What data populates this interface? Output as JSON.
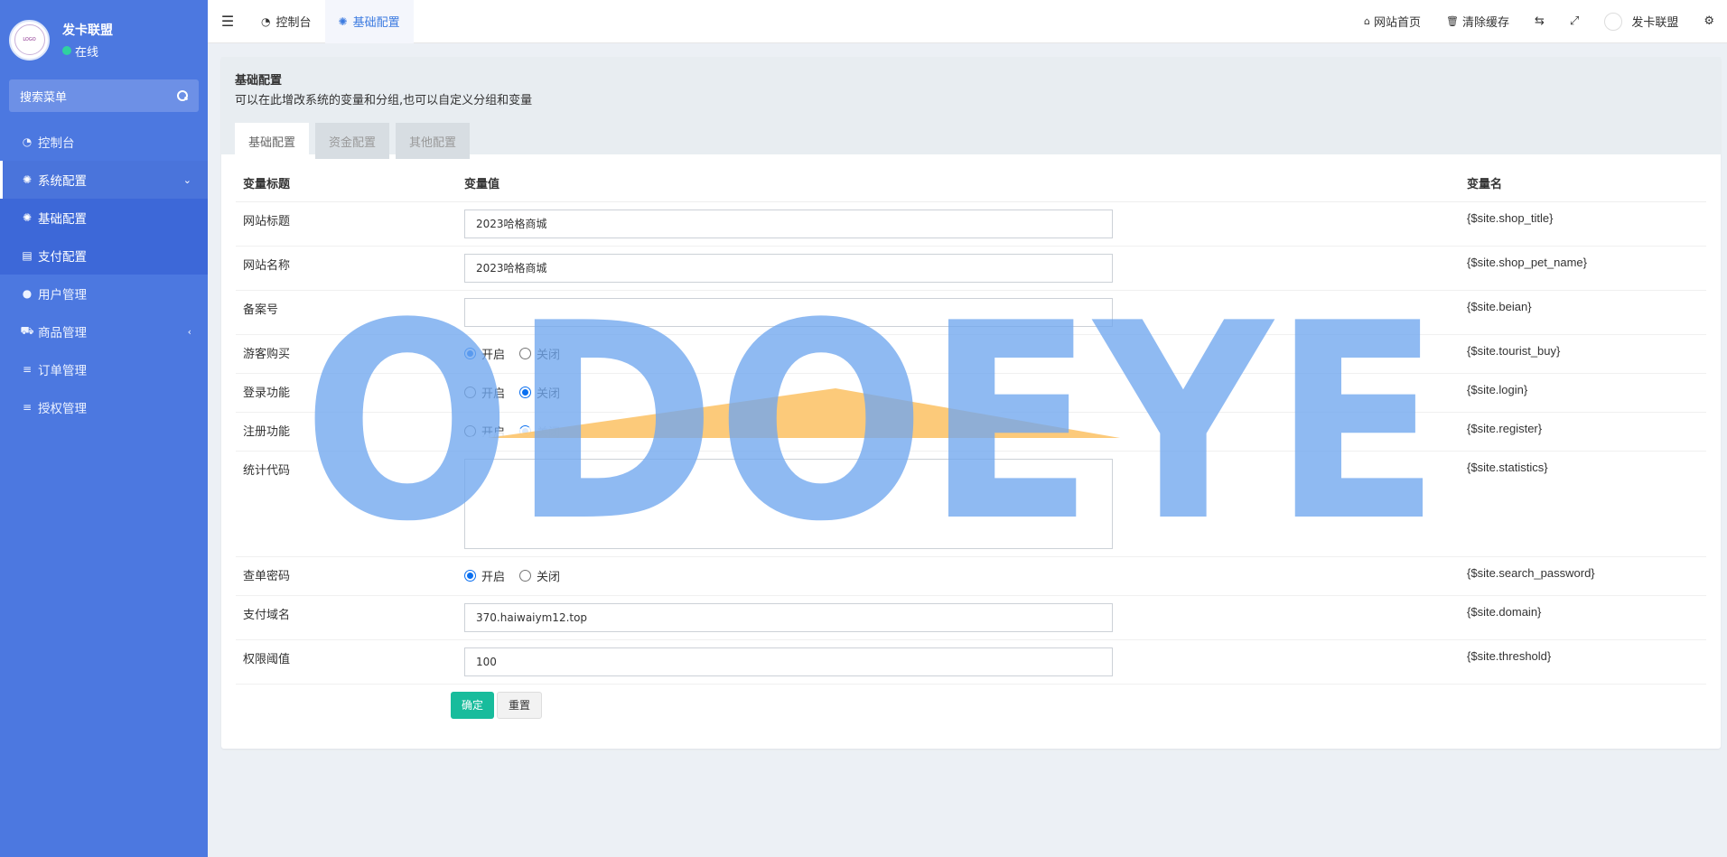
{
  "sidebar": {
    "user_name": "发卡联盟",
    "status": "在线",
    "search_placeholder": "搜索菜单",
    "items": [
      {
        "label": "控制台",
        "icon": "dashboard-icon"
      },
      {
        "label": "系统配置",
        "icon": "gear-icon"
      },
      {
        "label": "基础配置",
        "icon": "gear-icon"
      },
      {
        "label": "支付配置",
        "icon": "table-icon"
      },
      {
        "label": "用户管理",
        "icon": "user-icon"
      },
      {
        "label": "商品管理",
        "icon": "cart-icon"
      },
      {
        "label": "订单管理",
        "icon": "list-icon"
      },
      {
        "label": "授权管理",
        "icon": "list-icon"
      }
    ]
  },
  "topbar": {
    "tabs": [
      {
        "label": "控制台",
        "icon": "dashboard-icon"
      },
      {
        "label": "基础配置",
        "icon": "gear-icon"
      }
    ],
    "home": "网站首页",
    "clear_cache": "清除缓存",
    "user": "发卡联盟"
  },
  "panel": {
    "title": "基础配置",
    "desc": "可以在此增改系统的变量和分组,也可以自定义分组和变量",
    "tabs": [
      "基础配置",
      "资金配置",
      "其他配置"
    ]
  },
  "table": {
    "headers": [
      "变量标题",
      "变量值",
      "变量名"
    ],
    "rows": [
      {
        "label": "网站标题",
        "value": "2023哈格商城",
        "var": "{$site.shop_title}"
      },
      {
        "label": "网站名称",
        "value": "2023哈格商城",
        "var": "{$site.shop_pet_name}"
      },
      {
        "label": "备案号",
        "value": "",
        "var": "{$site.beian}"
      },
      {
        "label": "游客购买",
        "var": "{$site.tourist_buy}",
        "opt_on": "开启",
        "opt_off": "关闭",
        "selected": "开启"
      },
      {
        "label": "登录功能",
        "var": "{$site.login}",
        "opt_on": "开启",
        "opt_off": "关闭",
        "selected": "关闭"
      },
      {
        "label": "注册功能",
        "var": "{$site.register}",
        "opt_on": "开启",
        "opt_off": "关闭",
        "selected": "关闭"
      },
      {
        "label": "统计代码",
        "value": "",
        "var": "{$site.statistics}"
      },
      {
        "label": "查单密码",
        "var": "{$site.search_password}",
        "opt_on": "开启",
        "opt_off": "关闭",
        "selected": "开启"
      },
      {
        "label": "支付域名",
        "value": "370.haiwaiym12.top",
        "var": "{$site.domain}"
      },
      {
        "label": "权限阈值",
        "value": "100",
        "var": "{$site.threshold}"
      }
    ]
  },
  "buttons": {
    "submit": "确定",
    "reset": "重置"
  },
  "watermark": "ODOEYE",
  "colors": {
    "sidebar": "#4c78e0",
    "primary": "#18bc9c",
    "accent": "#3c7be0",
    "watermark_blue": "#6fa6ee",
    "watermark_orange": "#fcc46b"
  }
}
